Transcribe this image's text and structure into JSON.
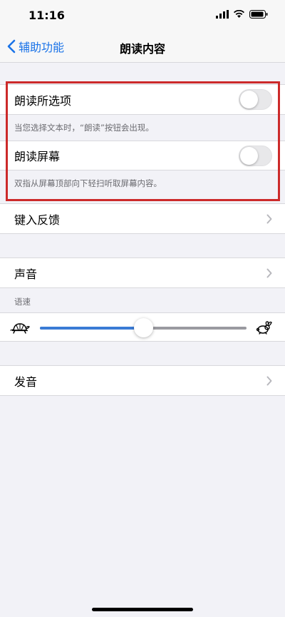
{
  "status": {
    "time": "11:16"
  },
  "nav": {
    "back_label": "辅助功能",
    "title": "朗读内容"
  },
  "speak_selection": {
    "label": "朗读所选项",
    "on": false,
    "footer": "当您选择文本时，“朗读”按钮会出现。"
  },
  "speak_screen": {
    "label": "朗读屏幕",
    "on": false,
    "footer": "双指从屏幕顶部向下轻扫听取屏幕内容。"
  },
  "typing_feedback": {
    "label": "键入反馈"
  },
  "voices": {
    "label": "声音"
  },
  "speaking_rate": {
    "section_label": "语速",
    "value_fraction": 0.5
  },
  "pronunciations": {
    "label": "发音"
  },
  "colors": {
    "accent": "#1a73e8",
    "highlight": "#cc2a2a"
  },
  "icons": {
    "back": "chevron-left-icon",
    "signal": "cellular-signal-icon",
    "wifi": "wifi-icon",
    "battery": "battery-icon",
    "chevron": "chevron-right-icon",
    "slow": "turtle-icon",
    "fast": "rabbit-icon"
  }
}
